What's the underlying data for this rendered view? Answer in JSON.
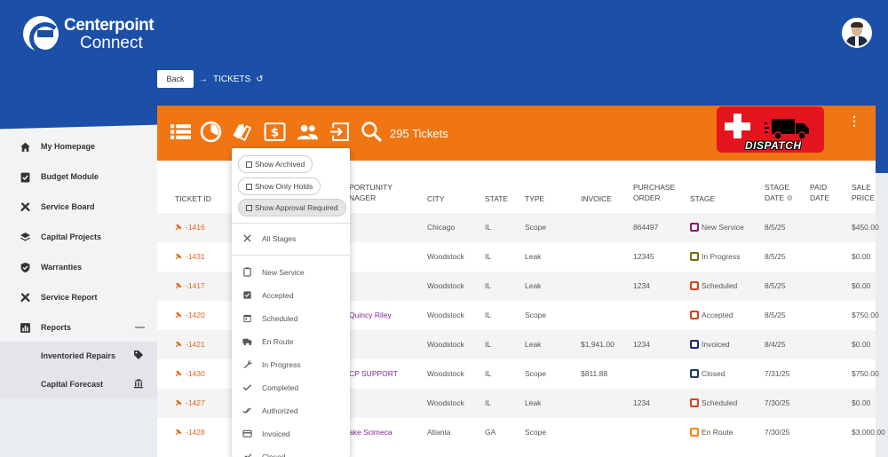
{
  "brand": {
    "line1": "Centerpoint",
    "line2": "Connect"
  },
  "breadcrumb": {
    "back_label": "Back",
    "current": "TICKETS"
  },
  "sidebar": {
    "items": [
      {
        "label": "My Homepage",
        "icon": "home-icon"
      },
      {
        "label": "Budget Module",
        "icon": "clipboard-check-icon"
      },
      {
        "label": "Service Board",
        "icon": "tools-icon"
      },
      {
        "label": "Capital Projects",
        "icon": "layers-icon"
      },
      {
        "label": "Warranties",
        "icon": "shield-check-icon"
      },
      {
        "label": "Service Report",
        "icon": "tools-icon"
      },
      {
        "label": "Reports",
        "icon": "bar-chart-icon",
        "trail": "—"
      }
    ],
    "subitems": [
      {
        "label": "Inventoried Repairs",
        "icon": "tag-icon"
      },
      {
        "label": "Capital Forecast",
        "icon": "bank-icon"
      }
    ]
  },
  "toolbar": {
    "ticket_count": "295 Tickets",
    "icons": [
      "list-icon",
      "pie-chart-icon",
      "tags-icon",
      "dollar-icon",
      "users-icon",
      "export-icon",
      "search-icon"
    ],
    "dispatch_label": "DISPATCH",
    "menu_glyph": "⋮"
  },
  "table": {
    "headers": {
      "ticket_id": "TICKET ID",
      "pm": "PORTUNITY NAGER",
      "city": "CITY",
      "state": "STATE",
      "type": "TYPE",
      "invoice": "INVOICE",
      "po": "PURCHASE ORDER",
      "stage": "STAGE",
      "stage_date": "STAGE DATE",
      "paid_date": "PAID DATE",
      "sale_price": "SALE PRICE"
    },
    "rows": [
      {
        "id": "-1416",
        "pm": "",
        "city": "Chicago",
        "state": "IL",
        "type": "Scope",
        "invoice": "",
        "po": "864497",
        "stage": "New Service",
        "stage_color": "#8a1d6b",
        "stage_date": "8/5/25",
        "paid": "",
        "price": "$450.00"
      },
      {
        "id": "-1431",
        "pm": "",
        "city": "Woodstock",
        "state": "IL",
        "type": "Leak",
        "invoice": "",
        "po": "12345",
        "stage": "In Progress",
        "stage_color": "#7a6a12",
        "stage_date": "8/5/25",
        "paid": "",
        "price": "$0.00"
      },
      {
        "id": "-1417",
        "pm": "",
        "city": "Woodstock",
        "state": "IL",
        "type": "Leak",
        "invoice": "",
        "po": "1234",
        "stage": "Scheduled",
        "stage_color": "#d9431e",
        "stage_date": "8/5/25",
        "paid": "",
        "price": "$0.00"
      },
      {
        "id": "-1420",
        "pm": "Quincy Riley",
        "city": "Woodstock",
        "state": "IL",
        "type": "Scope",
        "invoice": "",
        "po": "",
        "stage": "Accepted",
        "stage_color": "#d9431e",
        "stage_date": "8/5/25",
        "paid": "",
        "price": "$750.00"
      },
      {
        "id": "-1421",
        "pm": "",
        "city": "Woodstock",
        "state": "IL",
        "type": "Leak",
        "invoice": "$1,941.00",
        "po": "1234",
        "stage": "Invoiced",
        "stage_color": "#1f2a78",
        "stage_date": "8/4/25",
        "paid": "",
        "price": "$0.00"
      },
      {
        "id": "-1430",
        "pm": "CP SUPPORT",
        "city": "Woodstock",
        "state": "IL",
        "type": "Scope",
        "invoice": "$811.88",
        "po": "",
        "stage": "Closed",
        "stage_color": "#1d3a5a",
        "stage_date": "7/31/25",
        "paid": "",
        "price": "$750.00"
      },
      {
        "id": "-1427",
        "pm": "",
        "city": "Woodstock",
        "state": "IL",
        "type": "Leak",
        "invoice": "",
        "po": "1234",
        "stage": "Scheduled",
        "stage_color": "#d9431e",
        "stage_date": "7/30/25",
        "paid": "",
        "price": "$0.00"
      },
      {
        "id": "-1428",
        "pm": "ake Scimeca",
        "city": "Atlanta",
        "state": "GA",
        "type": "Scope",
        "invoice": "",
        "po": "",
        "stage": "En Route",
        "stage_color": "#f08a14",
        "stage_date": "7/30/25",
        "paid": "",
        "price": "$3,000.00"
      }
    ]
  },
  "dropdown": {
    "chips": [
      "Show Archived",
      "Show Only Holds",
      "Show Approval Required"
    ],
    "all_stages": "All Stages",
    "stages": [
      {
        "label": "New Service",
        "icon": "clipboard-icon"
      },
      {
        "label": "Accepted",
        "icon": "check-square-icon"
      },
      {
        "label": "Scheduled",
        "icon": "calendar-icon"
      },
      {
        "label": "En Route",
        "icon": "truck-icon"
      },
      {
        "label": "In Progress",
        "icon": "wrench-icon"
      },
      {
        "label": "Completed",
        "icon": "check-icon"
      },
      {
        "label": "Authorized",
        "icon": "double-check-icon"
      },
      {
        "label": "Invoiced",
        "icon": "card-icon"
      },
      {
        "label": "Closed",
        "icon": "trend-icon"
      }
    ]
  },
  "colors": {
    "header_blue": "#1c4fa8",
    "toolbar_orange": "#f07613",
    "ticket_link": "#e0661a",
    "pm_purple": "#7a2a90"
  }
}
